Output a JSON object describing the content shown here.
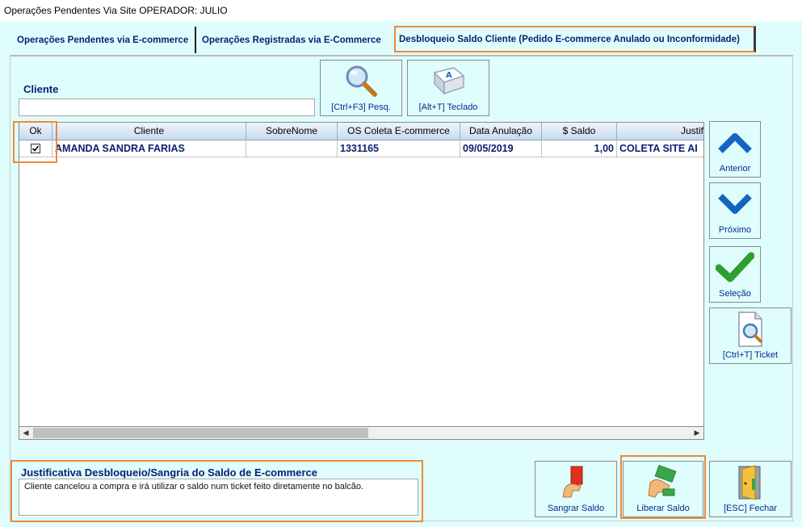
{
  "window": {
    "title": "Operações Pendentes Via Site OPERADOR: JULIO"
  },
  "tabs": [
    {
      "label": "Operações Pendentes via E-commerce"
    },
    {
      "label": "Operações Registradas via E-Commerce"
    },
    {
      "label": "Desbloqueio Saldo Cliente (Pedido E-commerce Anulado ou Inconformidade)"
    }
  ],
  "cliente": {
    "label": "Cliente",
    "value": ""
  },
  "toolbar": {
    "search_label": "[Ctrl+F3] Pesq.",
    "keyboard_label": "[Alt+T] Teclado"
  },
  "grid": {
    "columns": [
      "Ok",
      "Cliente",
      "SobreNome",
      "OS Coleta E-commerce",
      "Data Anulação",
      "$ Saldo",
      "Justif"
    ],
    "rows": [
      {
        "checked": true,
        "cliente": "AMANDA SANDRA FARIAS",
        "sobrenome": "",
        "os": "1331165",
        "data": "09/05/2019",
        "saldo": "1,00",
        "justif": "COLETA SITE AI"
      }
    ]
  },
  "side_buttons": {
    "anterior": "Anterior",
    "proximo": "Próximo",
    "selecao": "Seleção",
    "ticket": "[Ctrl+T] Ticket"
  },
  "justificativa": {
    "label": "Justificativa Desbloqueio/Sangria do Saldo de E-commerce",
    "text": "Cliente cancelou a compra e irá utilizar o saldo num ticket feito diretamente no balcão."
  },
  "bottom_buttons": {
    "sangrar": "Sangrar Saldo",
    "liberar": "Liberar Saldo",
    "fechar": "[ESC] Fechar"
  },
  "colors": {
    "panel": "#e0fdfd",
    "highlight": "#ee8a36",
    "text_blue": "#0a1e72",
    "arrow_blue": "#1565c0",
    "check_green": "#2e9e2e"
  }
}
